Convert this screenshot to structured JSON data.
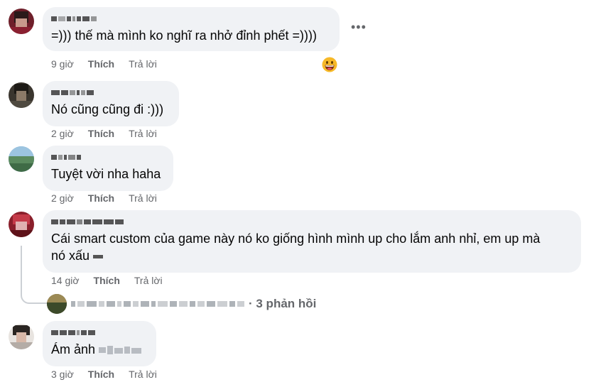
{
  "comments": [
    {
      "text": "=))) thế mà mình ko nghĩ ra nhở đỉnh phết =))))",
      "time": "9 giờ",
      "like_label": "Thích",
      "reply_label": "Trả lời",
      "more_icon": "three-dots-icon",
      "reaction_icon": "grinning-emoji-icon"
    },
    {
      "text": "Nó cũng cũng đi :)))",
      "time": "2 giờ",
      "like_label": "Thích",
      "reply_label": "Trả lời"
    },
    {
      "text": "Tuyệt vời nha haha",
      "time": "2 giờ",
      "like_label": "Thích",
      "reply_label": "Trả lời"
    },
    {
      "text_line1": "Cái smart custom của game này nó ko giống hình mình up cho lắm anh nhỉ, em up mà",
      "text_line2": "nó xấu",
      "time": "14 giờ",
      "like_label": "Thích",
      "reply_label": "Trả lời",
      "replies_summary": "· 3 phản hồi"
    },
    {
      "text": "Ám ảnh",
      "time": "3 giờ",
      "like_label": "Thích",
      "reply_label": "Trả lời"
    }
  ],
  "colors": {
    "bubble_bg": "#f0f2f5",
    "meta_text": "#65676b",
    "body_text": "#050505"
  }
}
